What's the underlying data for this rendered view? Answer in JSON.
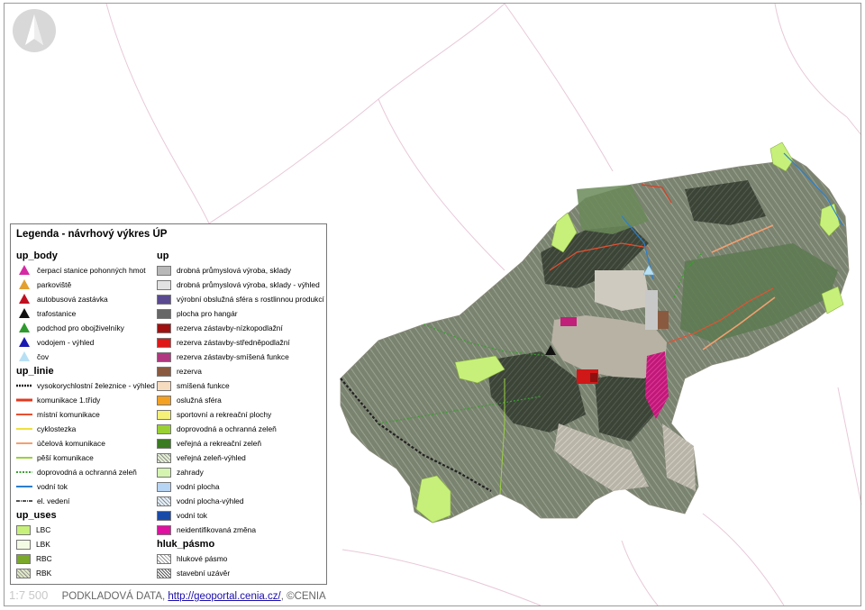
{
  "legend": {
    "title": "Legenda - návrhový výkres ÚP",
    "sections": {
      "up_body": "up_body",
      "up_linie": "up_linie",
      "up_uses": "up_uses",
      "up": "up",
      "hluk_pasmo": "hluk_pásmo"
    },
    "up_body": [
      {
        "label": "čerpací stanice pohonných hmot",
        "color": "#d62aa4",
        "icon": "triangle-icon"
      },
      {
        "label": "parkoviště",
        "color": "#e2a030",
        "icon": "triangle-icon"
      },
      {
        "label": "autobusová zastávka",
        "color": "#c01020",
        "icon": "triangle-icon"
      },
      {
        "label": "trafostanice",
        "color": "#111111",
        "icon": "triangle-icon"
      },
      {
        "label": "podchod pro obojživelníky",
        "color": "#2e9a2e",
        "icon": "triangle-icon"
      },
      {
        "label": "vodojem - výhled",
        "color": "#1a1ab0",
        "icon": "triangle-icon"
      },
      {
        "label": "čov",
        "color": "#b8e0f4",
        "icon": "triangle-icon"
      }
    ],
    "up_linie": [
      {
        "label": "vysokorychlostní železnice - výhled",
        "color": "#222222",
        "style": "rail"
      },
      {
        "label": "komunikace 1.třídy",
        "color": "#e03a20",
        "style": "thick"
      },
      {
        "label": "místní komunikace",
        "color": "#e85030",
        "style": "solid"
      },
      {
        "label": "cyklostezka",
        "color": "#f0e040",
        "style": "solid"
      },
      {
        "label": "účelová komunikace",
        "color": "#f4a070",
        "style": "solid"
      },
      {
        "label": "pěší komunikace",
        "color": "#9ad040",
        "style": "solid"
      },
      {
        "label": "doprovodná a ochranná zeleň",
        "color": "#3aa030",
        "style": "dotted"
      },
      {
        "label": "vodní tok",
        "color": "#2a7fd0",
        "style": "solid"
      },
      {
        "label": "el. vedení",
        "color": "#555555",
        "style": "dashdot"
      }
    ],
    "up_uses": [
      {
        "label": "LBC",
        "color": "#c6f07a",
        "style": "fill"
      },
      {
        "label": "LBK",
        "color": "#f4fbe4",
        "style": "fill"
      },
      {
        "label": "RBC",
        "color": "#7aa82a",
        "style": "fill"
      },
      {
        "label": "RBK",
        "color": "#e0e8c8",
        "style": "hatch"
      }
    ],
    "up": [
      {
        "label": "drobná průmyslová výroba, sklady",
        "color": "#b8b8b8",
        "style": "fill"
      },
      {
        "label": "drobná průmyslová výroba, sklady - výhled",
        "color": "#e2e2e2",
        "style": "fill"
      },
      {
        "label": "výrobní obslužná sféra s rostlinnou produkcí",
        "color": "#5a4a90",
        "style": "fill"
      },
      {
        "label": "plocha pro hangár",
        "color": "#666666",
        "style": "fill"
      },
      {
        "label": "rezerva zástavby-nízkopodlažní",
        "color": "#a01010",
        "style": "fill"
      },
      {
        "label": "rezerva zástavby-středněpodlažní",
        "color": "#e01818",
        "style": "fill"
      },
      {
        "label": "rezerva zástavby-smíšená funkce",
        "color": "#b03880",
        "style": "fill"
      },
      {
        "label": "rezerva",
        "color": "#8a5a40",
        "style": "fill"
      },
      {
        "label": "smíšená funkce",
        "color": "#f8dcc0",
        "style": "fill"
      },
      {
        "label": "oslužná sféra",
        "color": "#f4a020",
        "style": "fill"
      },
      {
        "label": "sportovní a rekreační plochy",
        "color": "#f4f078",
        "style": "fill"
      },
      {
        "label": "doprovodná a ochranná zeleň",
        "color": "#9ad034",
        "style": "fill"
      },
      {
        "label": "veřejná a rekreační zeleň",
        "color": "#3a7a20",
        "style": "fill"
      },
      {
        "label": "veřejná zeleň-výhled",
        "color": "#e4f0d4",
        "style": "hatch"
      },
      {
        "label": "zahrady",
        "color": "#d4f4b0",
        "style": "fill"
      },
      {
        "label": "vodní plocha",
        "color": "#b8d4f4",
        "style": "fill"
      },
      {
        "label": "vodní plocha-výhled",
        "color": "#e4f0fa",
        "style": "hatch"
      },
      {
        "label": "vodní tok",
        "color": "#1a4aa8",
        "style": "fill"
      },
      {
        "label": "neidentifikovaná změna",
        "color": "#e010a0",
        "style": "fill"
      }
    ],
    "hluk_pasmo": [
      {
        "label": "hlukové pásmo",
        "color": "#ffffff",
        "style": "hatch"
      },
      {
        "label": "stavební uzávěr",
        "color": "#ffffff",
        "style": "hatch-dense"
      }
    ]
  },
  "footer": {
    "scale": "1:7 500",
    "source_prefix": "PODKLADOVÁ DATA,",
    "link": "http://geoportal.cenia.cz/",
    "source_suffix": ", ©CENIA"
  }
}
